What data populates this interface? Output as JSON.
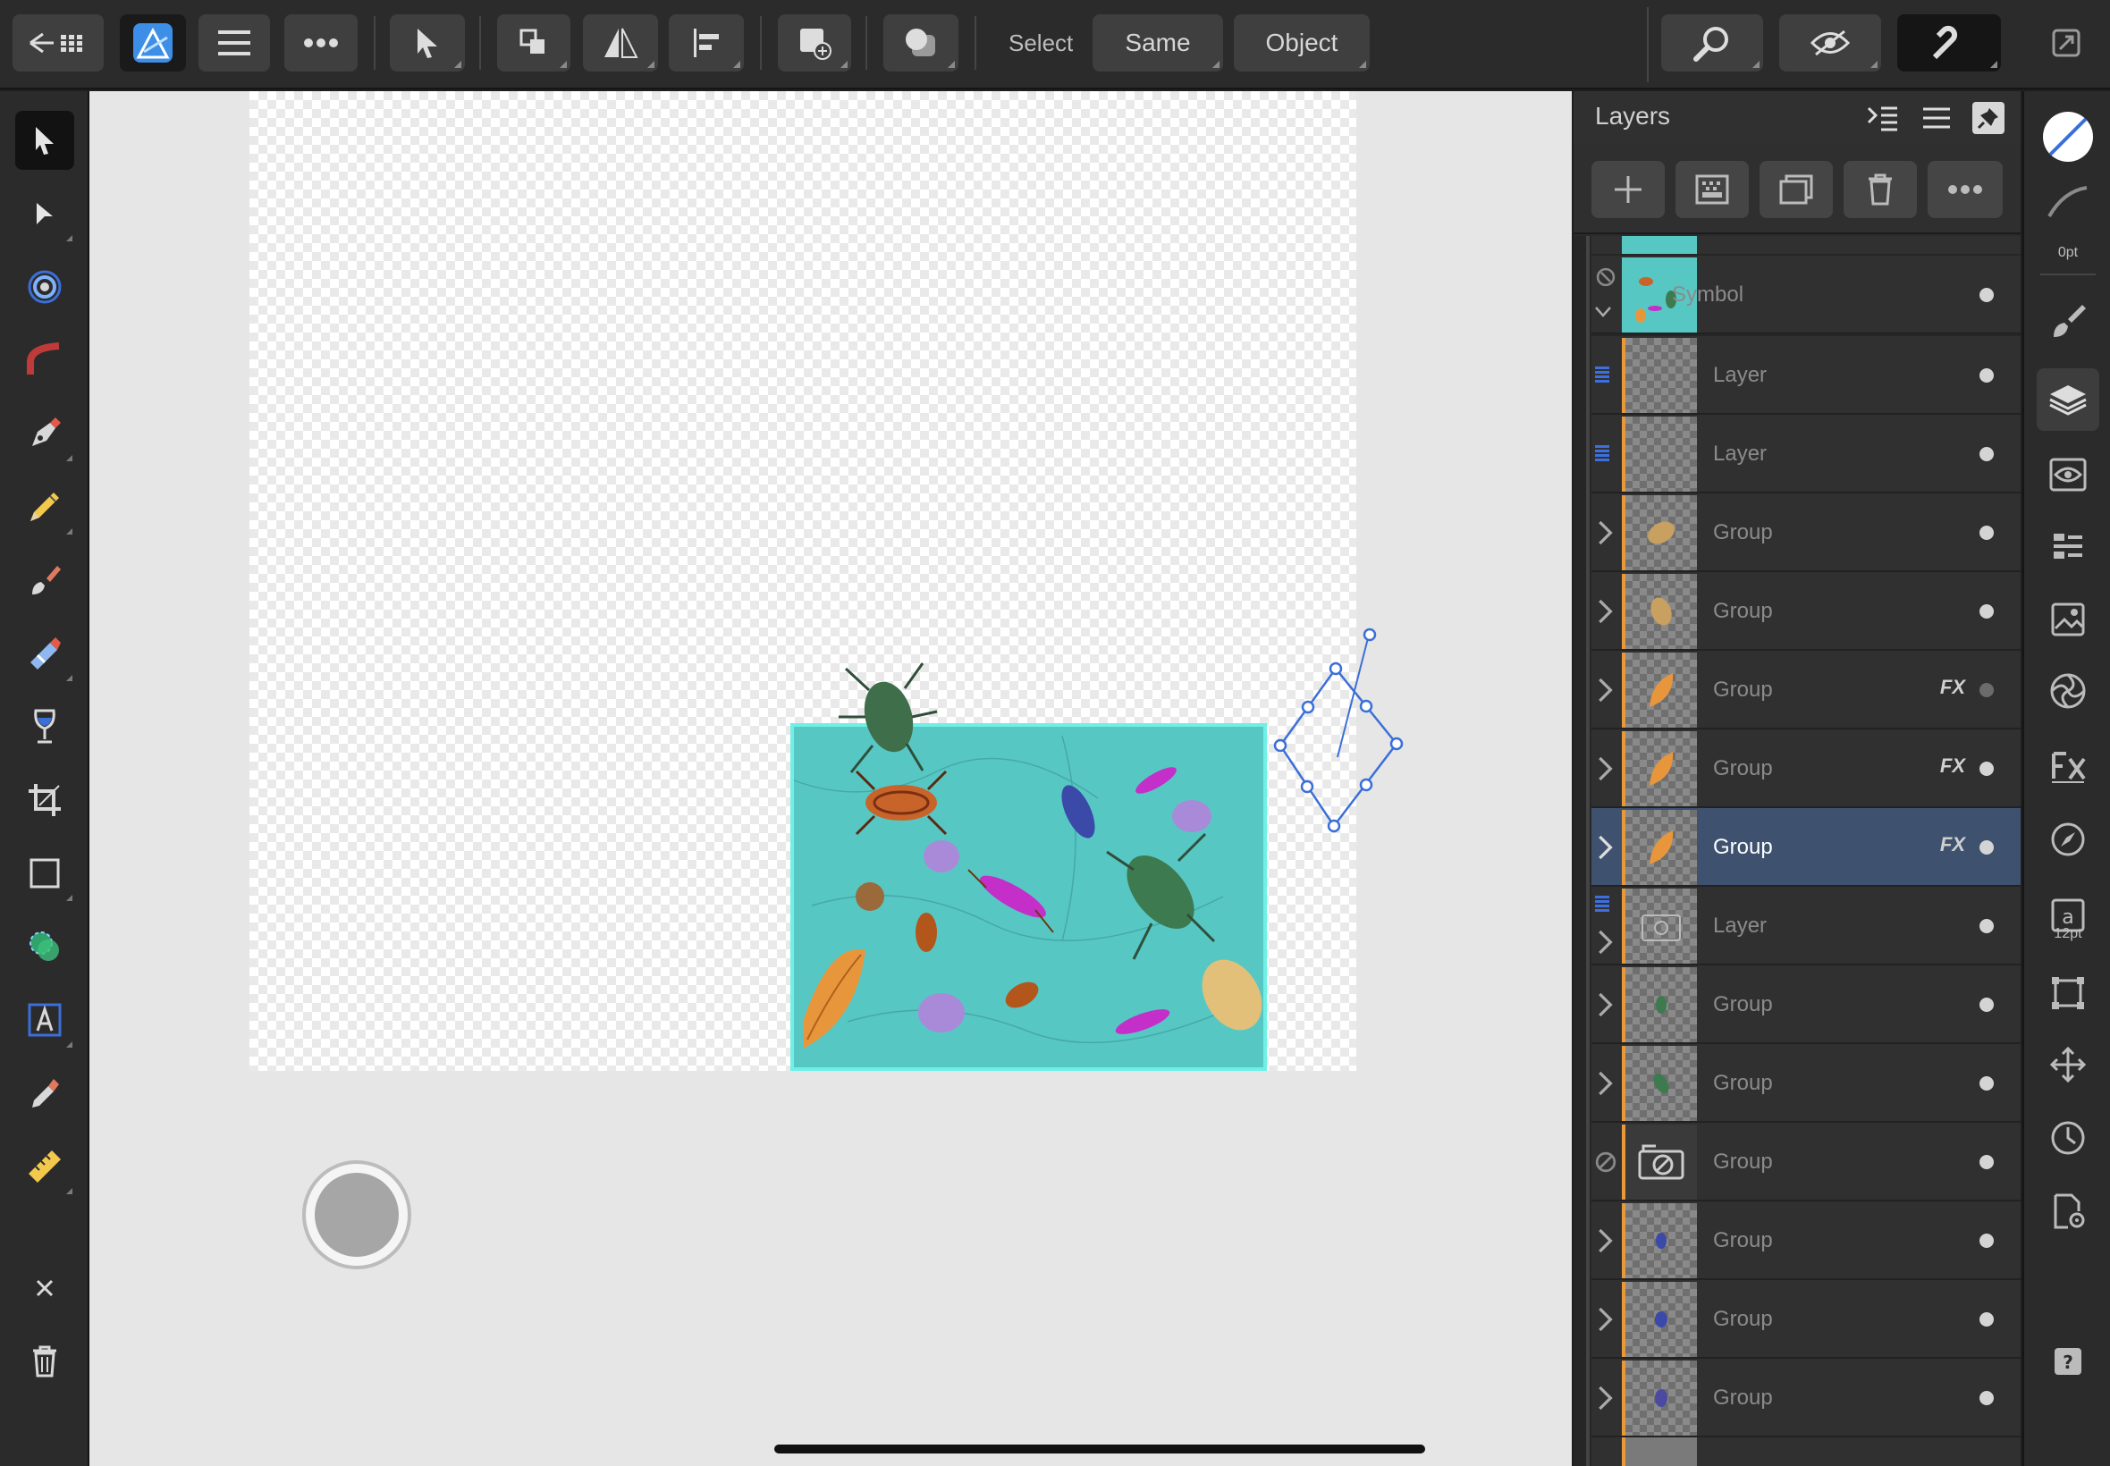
{
  "toolbar": {
    "select_label": "Select",
    "same_label": "Same",
    "object_label": "Object"
  },
  "layers": {
    "title": "Layers",
    "rows": [
      {
        "name": "Symbol",
        "type": "symbol",
        "fx": false,
        "selected": false
      },
      {
        "name": "Layer",
        "type": "layer",
        "fx": false,
        "selected": false
      },
      {
        "name": "Layer",
        "type": "layer",
        "fx": false,
        "selected": false
      },
      {
        "name": "Group",
        "type": "group",
        "fx": false,
        "selected": false
      },
      {
        "name": "Group",
        "type": "group",
        "fx": false,
        "selected": false
      },
      {
        "name": "Group",
        "type": "group",
        "fx": true,
        "selected": false
      },
      {
        "name": "Group",
        "type": "group",
        "fx": true,
        "selected": false
      },
      {
        "name": "Group",
        "type": "group",
        "fx": true,
        "selected": true
      },
      {
        "name": "Layer",
        "type": "layer",
        "fx": false,
        "selected": false
      },
      {
        "name": "Group",
        "type": "group",
        "fx": false,
        "selected": false
      },
      {
        "name": "Group",
        "type": "group",
        "fx": false,
        "selected": false
      },
      {
        "name": "Group",
        "type": "group",
        "fx": false,
        "selected": false
      },
      {
        "name": "Group",
        "type": "group",
        "fx": false,
        "selected": false
      },
      {
        "name": "Group",
        "type": "group",
        "fx": false,
        "selected": false
      },
      {
        "name": "Group",
        "type": "group",
        "fx": false,
        "selected": false
      }
    ],
    "fx_label": "FX"
  },
  "studio": {
    "stroke_width_label": "0pt",
    "font_size_label": "12pt"
  },
  "colors": {
    "accent": "#3e5270",
    "tile": "#57c7c4",
    "handle": "#3b6fd8"
  }
}
